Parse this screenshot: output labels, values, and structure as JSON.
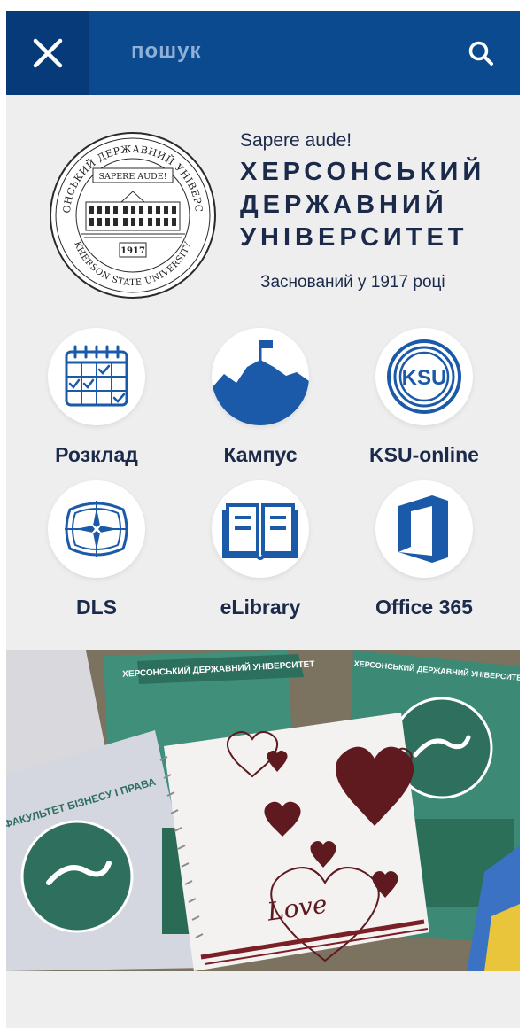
{
  "header": {
    "search_placeholder": "пошук",
    "motto": "Sapere aude!",
    "university_name_lines": [
      "ХЕРСОНСЬКИЙ",
      "ДЕРЖАВНИЙ",
      "УНІВЕРСИТЕТ"
    ],
    "founded": "Заснований у 1917 році"
  },
  "seal": {
    "top_text": "ХЕРСОНСЬКИЙ ДЕРЖАВНИЙ УНІВЕРСИТЕТ",
    "bottom_text": "KHERSON STATE UNIVERSITY",
    "banner": "SAPERE AUDE!",
    "year": "1917"
  },
  "shortcuts": [
    {
      "label": "Розклад",
      "icon": "calendar-icon"
    },
    {
      "label": "Кампус",
      "icon": "campus-flag-icon"
    },
    {
      "label": "KSU-online",
      "icon": "ksu-online-icon"
    },
    {
      "label": "DLS",
      "icon": "compass-star-icon"
    },
    {
      "label": "eLibrary",
      "icon": "open-book-icon"
    },
    {
      "label": "Office 365",
      "icon": "office-icon"
    }
  ],
  "icons": {
    "ksu_badge": "KSU"
  },
  "banner": {
    "headline": "ХЕРСОНСЬКИЙ ДЕРЖАВНИЙ УНІВЕРСИТЕТ",
    "faculty": "ФАКУЛЬТЕТ БІЗНЕСУ І ПРАВА",
    "notebook_text": "Love"
  },
  "colors": {
    "primary": "#0b4a8f",
    "primary_dark": "#063a78",
    "accent": "#1a5aa8",
    "text": "#1b2a4a"
  }
}
